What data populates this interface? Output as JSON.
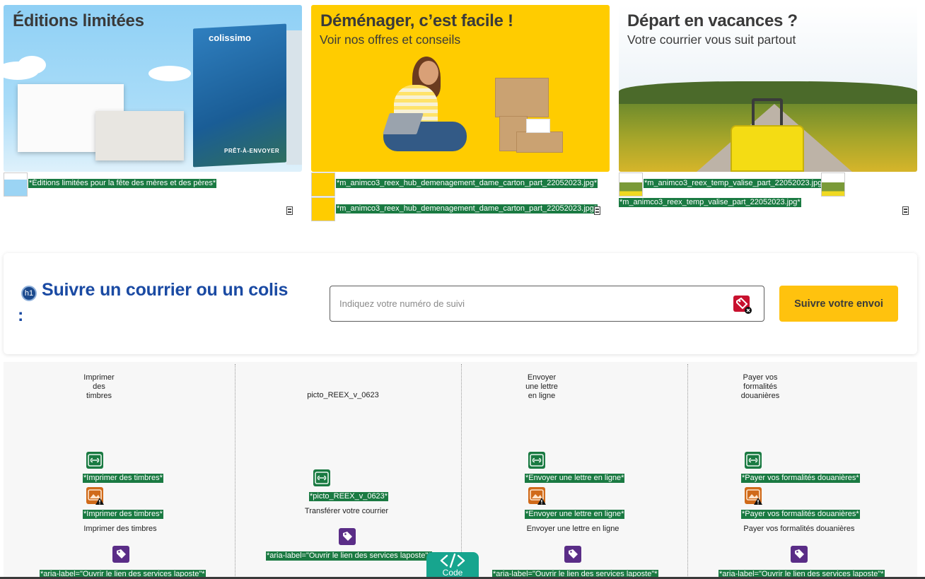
{
  "banners": [
    {
      "title": "Éditions limitées",
      "subtitle": "",
      "brand": "colissimo",
      "pkg_label": "PRÊT-À-ENVOYER",
      "thumb_caption": "*Éditions limitées pour la fête des mères et des pères*"
    },
    {
      "title": "Déménager, c’est facile !",
      "subtitle": "Voir nos offres et conseils",
      "thumb_caption": "*m_animco3_reex_hub_demenagement_dame_carton_part_22052023.jpg*",
      "thumb_caption_2": "*m_animco3_reex_hub_demenagement_dame_carton_part_22052023.jpg*"
    },
    {
      "title": "Départ en vacances ?",
      "subtitle": "Votre courrier vous suit partout",
      "thumb_caption": "*m_animco3_reex_temp_valise_part_22052023.jpg*",
      "thumb_caption_2": "*m_animco3_reex_temp_valise_part_22052023.jpg*"
    }
  ],
  "tracking": {
    "h1_badge": "h1",
    "title": "Suivre un courrier ou un colis",
    "colon": ":",
    "placeholder": "Indiquez votre numéro de suivi",
    "button": "Suivre votre envoi"
  },
  "services": [
    {
      "heading": "Imprimer des timbres",
      "alt_tag": "*Imprimer des timbres*",
      "alt_tag_2": "*Imprimer des timbres*",
      "label": "Imprimer des timbres",
      "aria": "*aria-label=\"Ouvrir le lien des services laposte\"*"
    },
    {
      "heading": "picto_REEX_v_0623",
      "alt_tag": "*picto_REEX_v_0623*",
      "label": "Transférer votre courrier",
      "aria": "*aria-label=\"Ouvrir le lien des services laposte\"*"
    },
    {
      "heading": "Envoyer une lettre en ligne",
      "alt_tag": "*Envoyer une lettre en ligne*",
      "alt_tag_2": "*Envoyer une lettre en ligne*",
      "label": "Envoyer une lettre en ligne",
      "aria": "*aria-label=\"Ouvrir le lien des services laposte\"*"
    },
    {
      "heading": "Payer vos formalités douanières",
      "alt_tag": "*Payer vos formalités douanières*",
      "alt_tag_2": "*Payer vos formalités douanières*",
      "label": "Payer vos formalités douanières",
      "aria": "*aria-label=\"Ouvrir le lien des services laposte\"*"
    }
  ],
  "code_badge": "Code",
  "colors": {
    "accent_yellow": "#ffc20e",
    "title_blue": "#1a4aa3",
    "tag_green": "#1a7a42",
    "code_teal": "#17a58e"
  }
}
